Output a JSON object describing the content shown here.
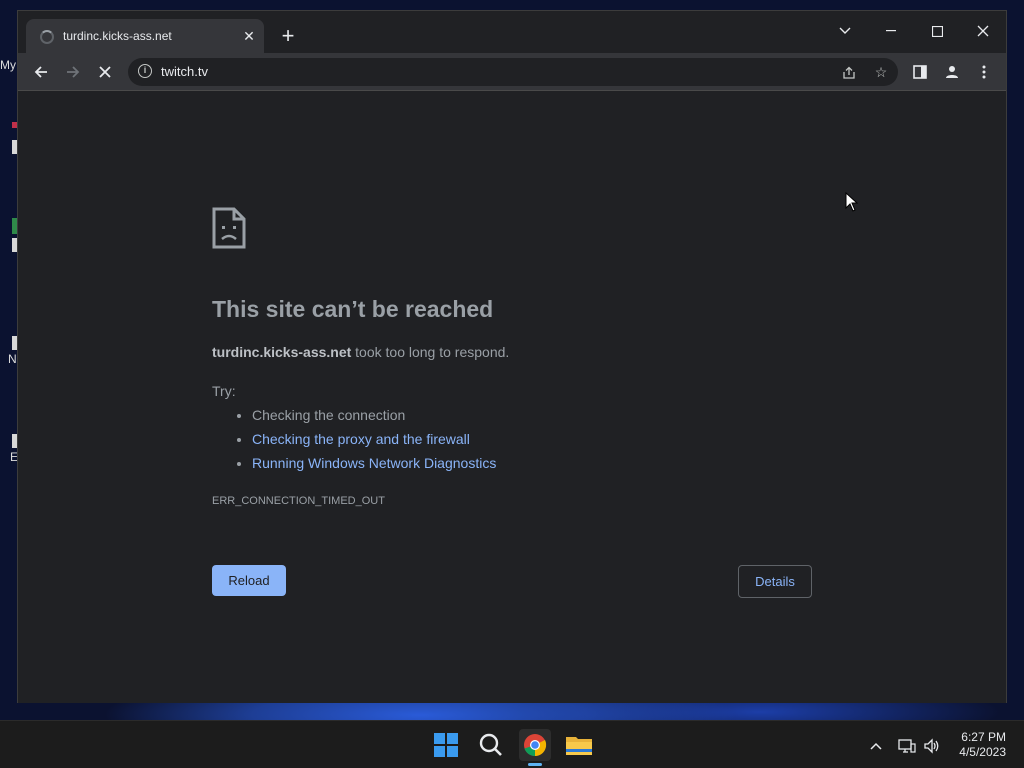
{
  "desktop": {
    "icons": [
      "My",
      "N",
      "E"
    ]
  },
  "browser": {
    "tab": {
      "title": "turdinc.kicks-ass.net"
    },
    "address_bar": {
      "url": "twitch.tv"
    },
    "page": {
      "title": "This site can’t be reached",
      "host": "turdinc.kicks-ass.net",
      "message": " took too long to respond.",
      "try_label": "Try:",
      "suggestions": [
        "Checking the connection",
        "Checking the proxy and the firewall",
        "Running Windows Network Diagnostics"
      ],
      "error_code": "ERR_CONNECTION_TIMED_OUT",
      "reload_label": "Reload",
      "details_label": "Details"
    }
  },
  "taskbar": {
    "time": "6:27 PM",
    "date": "4/5/2023"
  },
  "colors": {
    "accent": "#8ab4f8",
    "page_bg": "#202124",
    "text_muted": "#9aa0a6"
  }
}
